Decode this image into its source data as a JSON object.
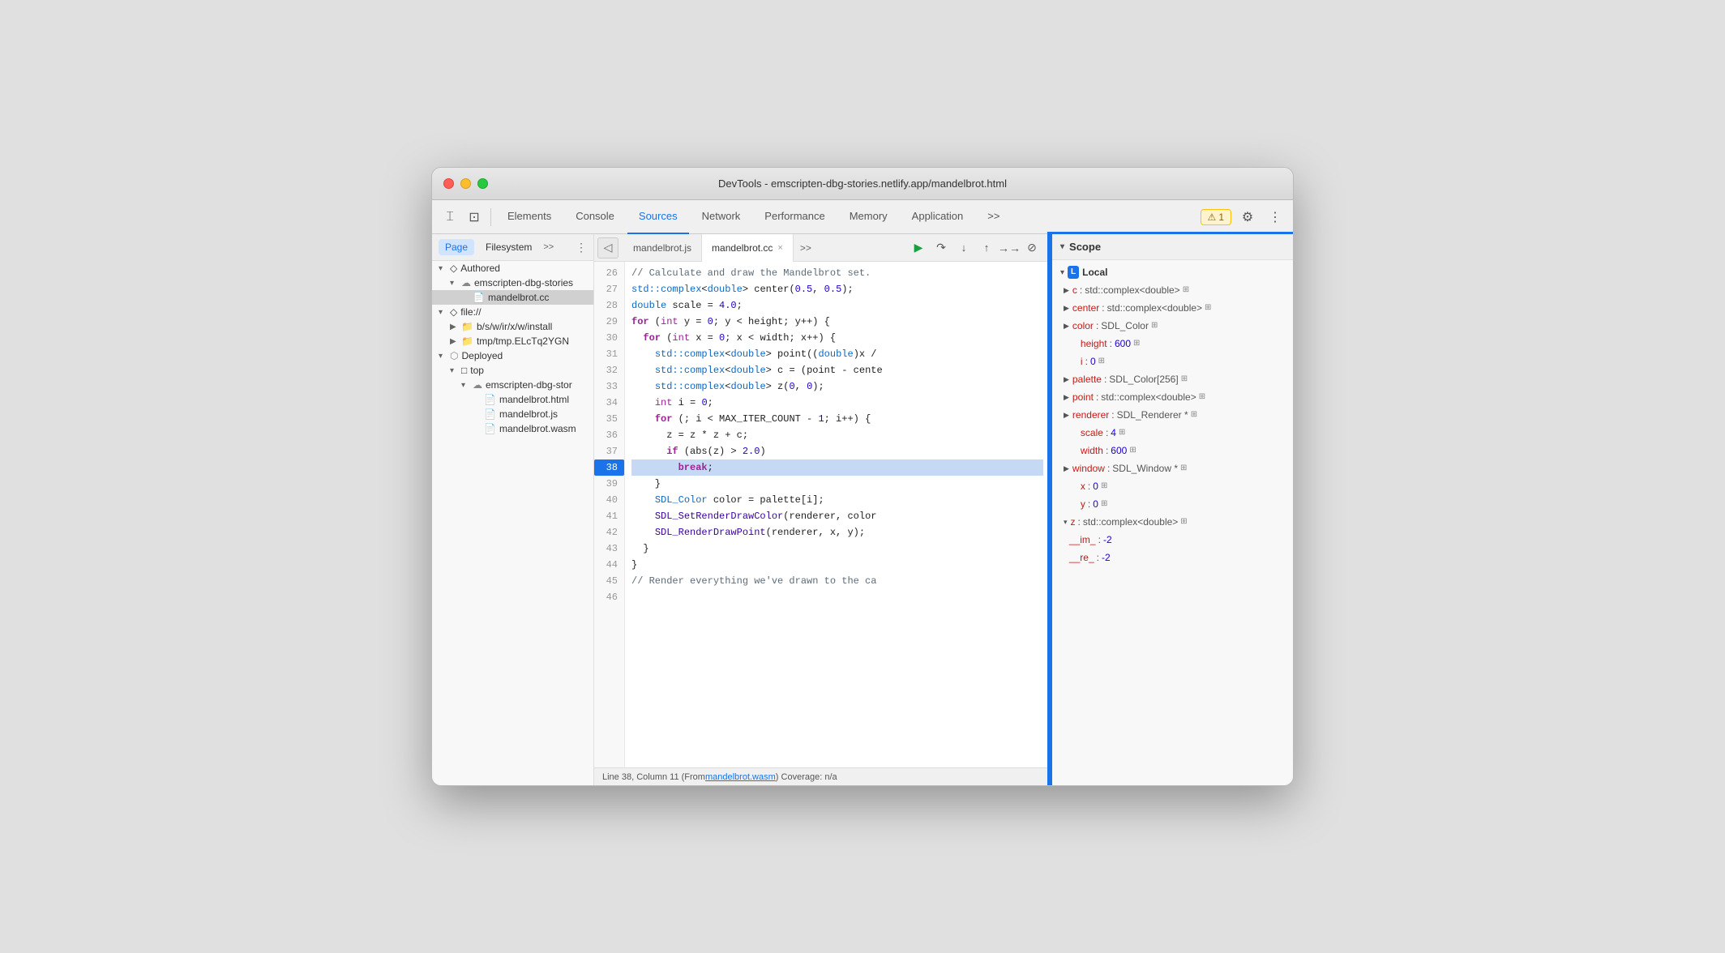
{
  "window": {
    "title": "DevTools - emscripten-dbg-stories.netlify.app/mandelbrot.html"
  },
  "toolbar": {
    "tabs": [
      {
        "id": "elements",
        "label": "Elements",
        "active": false
      },
      {
        "id": "console",
        "label": "Console",
        "active": false
      },
      {
        "id": "sources",
        "label": "Sources",
        "active": true
      },
      {
        "id": "network",
        "label": "Network",
        "active": false
      },
      {
        "id": "performance",
        "label": "Performance",
        "active": false
      },
      {
        "id": "memory",
        "label": "Memory",
        "active": false
      },
      {
        "id": "application",
        "label": "Application",
        "active": false
      }
    ],
    "more_tabs_label": ">>",
    "warning_count": "1"
  },
  "sidebar": {
    "tabs": [
      {
        "label": "Page",
        "active": true
      },
      {
        "label": "Filesystem",
        "active": false
      }
    ],
    "more_label": ">>",
    "tree": {
      "authored_label": "Authored",
      "emscripten_label": "emscripten-dbg-stories",
      "mandelbrot_cc_label": "mandelbrot.cc",
      "file_label": "file://",
      "bswir_label": "b/s/w/ir/x/w/install",
      "tmp_label": "tmp/tmp.ELcTq2YGN",
      "deployed_label": "Deployed",
      "top_label": "top",
      "emscripten_deployed_label": "emscripten-dbg-stor",
      "mandelbrot_html_label": "mandelbrot.html",
      "mandelbrot_js_label": "mandelbrot.js",
      "mandelbrot_wasm_label": "mandelbrot.wasm"
    }
  },
  "file_tabs": {
    "tabs": [
      {
        "label": "mandelbrot.js",
        "active": false,
        "closeable": false
      },
      {
        "label": "mandelbrot.cc",
        "active": true,
        "closeable": true
      }
    ],
    "more_label": ">>"
  },
  "code": {
    "lines": [
      {
        "num": "26",
        "content": "// Calculate and draw the Mandelbrot set.",
        "type": "comment"
      },
      {
        "num": "27",
        "content": "std::complex<double> center(0.5, 0.5);",
        "type": "code"
      },
      {
        "num": "28",
        "content": "double scale = 4.0;",
        "type": "code"
      },
      {
        "num": "29",
        "content": "for (int y = 0; y < height; y++) {",
        "type": "code"
      },
      {
        "num": "30",
        "content": "  for (int x = 0; x < width; x++) {",
        "type": "code"
      },
      {
        "num": "31",
        "content": "    std::complex<double> point((double)x /",
        "type": "code"
      },
      {
        "num": "32",
        "content": "    std::complex<double> c = (point - cente",
        "type": "code"
      },
      {
        "num": "33",
        "content": "    std::complex<double> z(0, 0);",
        "type": "code"
      },
      {
        "num": "34",
        "content": "    int i = 0;",
        "type": "code"
      },
      {
        "num": "35",
        "content": "    for (; i < MAX_ITER_COUNT - 1; i++) {",
        "type": "code"
      },
      {
        "num": "36",
        "content": "      z = z * z + c;",
        "type": "code"
      },
      {
        "num": "37",
        "content": "      if (abs(z) > 2.0)",
        "type": "code"
      },
      {
        "num": "38",
        "content": "        break;",
        "type": "code",
        "highlighted": true,
        "breakpoint": true
      },
      {
        "num": "39",
        "content": "    }",
        "type": "code"
      },
      {
        "num": "40",
        "content": "    SDL_Color color = palette[i];",
        "type": "code"
      },
      {
        "num": "41",
        "content": "    SDL_SetRenderDrawColor(renderer, color",
        "type": "code"
      },
      {
        "num": "42",
        "content": "    SDL_RenderDrawPoint(renderer, x, y);",
        "type": "code"
      },
      {
        "num": "43",
        "content": "  }",
        "type": "code"
      },
      {
        "num": "44",
        "content": "}",
        "type": "code"
      },
      {
        "num": "45",
        "content": "",
        "type": "code"
      },
      {
        "num": "46",
        "content": "// Render everything we've drawn to the ca",
        "type": "comment"
      }
    ]
  },
  "status_bar": {
    "text": "Line 38, Column 11 (From ",
    "link": "mandelbrot.wasm",
    "text2": ") Coverage: n/a"
  },
  "scope": {
    "title": "Scope",
    "local_label": "Local",
    "local_badge": "L",
    "properties": [
      {
        "key": "c",
        "val": "std::complex<double>",
        "expandable": true,
        "has_icon": true
      },
      {
        "key": "center",
        "val": "std::complex<double>",
        "expandable": true,
        "has_icon": true
      },
      {
        "key": "color",
        "val": "SDL_Color",
        "expandable": true,
        "has_icon": true
      },
      {
        "key": "height",
        "val": "600",
        "expandable": false,
        "is_num": true,
        "has_icon": true
      },
      {
        "key": "i",
        "val": "0",
        "expandable": false,
        "is_num": true,
        "has_icon": true
      },
      {
        "key": "palette",
        "val": "SDL_Color[256]",
        "expandable": true,
        "has_icon": true
      },
      {
        "key": "point",
        "val": "std::complex<double>",
        "expandable": true,
        "has_icon": true
      },
      {
        "key": "renderer",
        "val": "SDL_Renderer *",
        "expandable": true,
        "has_icon": true
      },
      {
        "key": "scale",
        "val": "4",
        "expandable": false,
        "is_num": true,
        "has_icon": true
      },
      {
        "key": "width",
        "val": "600",
        "expandable": false,
        "is_num": true,
        "has_icon": true
      },
      {
        "key": "window",
        "val": "SDL_Window *",
        "expandable": true,
        "has_icon": true
      },
      {
        "key": "x",
        "val": "0",
        "expandable": false,
        "is_num": true,
        "has_icon": true
      },
      {
        "key": "y",
        "val": "0",
        "expandable": false,
        "is_num": true,
        "has_icon": true
      },
      {
        "key": "z",
        "val": "std::complex<double>",
        "expandable": true,
        "is_expanded": true,
        "has_icon": true
      },
      {
        "key": "__im_",
        "val": "-2",
        "expandable": false,
        "is_num": true,
        "nested": true
      },
      {
        "key": "__re_",
        "val": "-2",
        "expandable": false,
        "is_num": true,
        "nested": true
      }
    ]
  },
  "icons": {
    "cursor": "⌶",
    "device": "⊡",
    "arrow_left": "◂",
    "arrow_right": "▸",
    "arrow_down": "▾",
    "arrow_up": "▴",
    "dots_h": "⋯",
    "close": "×",
    "gear": "⚙",
    "dots_v": "⋮",
    "warning": "⚠",
    "play": "▶",
    "pause": "⏸",
    "step_over": "↷",
    "step_into": "↓",
    "step_out": "↑",
    "step_back": "→→",
    "deactivate": "⊘"
  }
}
